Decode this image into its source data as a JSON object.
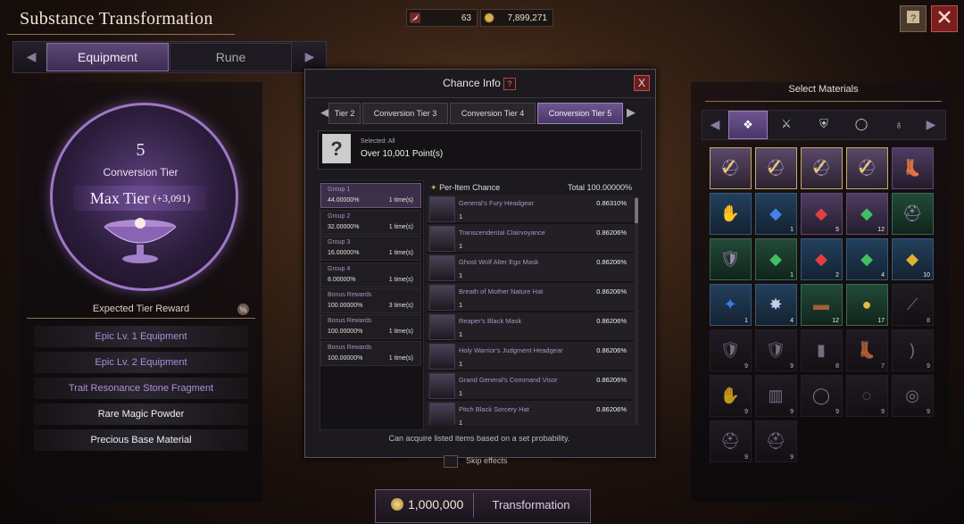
{
  "header": {
    "title": "Substance Transformation",
    "currency1": {
      "icon": "feather-icon",
      "value": "63"
    },
    "currency2": {
      "icon": "gold-coin-icon",
      "value": "7,899,271"
    }
  },
  "left": {
    "tabs": {
      "equipment": "Equipment",
      "rune": "Rune"
    },
    "tier": {
      "number": "5",
      "label": "Conversion Tier",
      "max_label": "Max Tier",
      "bonus": "(+3,091)"
    },
    "expected_title": "Expected Tier Reward",
    "pct_badge": "%",
    "rewards": [
      {
        "label": "Epic Lv. 1 Equipment",
        "color": "#b08ed9"
      },
      {
        "label": "Epic Lv. 2 Equipment",
        "color": "#b08ed9"
      },
      {
        "label": "Trait Resonance Stone Fragment",
        "color": "#b08ed9"
      },
      {
        "label": "Rare Magic Powder",
        "color": "#f0f0f0"
      },
      {
        "label": "Precious Base Material",
        "color": "#f0f0f0"
      }
    ]
  },
  "modal": {
    "title": "Chance Info",
    "help": "?",
    "close": "X",
    "tabs": [
      "Tier 2",
      "Conversion Tier 3",
      "Conversion Tier 4",
      "Conversion Tier 5"
    ],
    "tab0_visible": "Tier 2",
    "selected_label": "Selected: All",
    "selected_value": "Over 10,001 Point(s)",
    "groups": [
      {
        "name": "Group 1",
        "pct": "44.00000%",
        "times": "1 time(s)"
      },
      {
        "name": "Group 2",
        "pct": "32.00000%",
        "times": "1 time(s)"
      },
      {
        "name": "Group 3",
        "pct": "16.00000%",
        "times": "1 time(s)"
      },
      {
        "name": "Group 4",
        "pct": "8.00000%",
        "times": "1 time(s)"
      },
      {
        "name": "Bonus Rewards",
        "pct": "100.00000%",
        "times": "3 time(s)"
      },
      {
        "name": "Bonus Rewards",
        "pct": "100.00000%",
        "times": "1 time(s)"
      },
      {
        "name": "Bonus Rewards",
        "pct": "100.00000%",
        "times": "1 time(s)"
      }
    ],
    "list_header_left": "Per-Item Chance",
    "list_header_right": "Total 100.00000%",
    "items": [
      {
        "name": "General's Fury Headgear",
        "pct": "0.86310%",
        "count": "1"
      },
      {
        "name": "Transcendental Clairvoyance",
        "pct": "0.86206%",
        "count": "1"
      },
      {
        "name": "Ghost Wolf Alter Ego Mask",
        "pct": "0.86206%",
        "count": "1"
      },
      {
        "name": "Breath of Mother Nature Hat",
        "pct": "0.86206%",
        "count": "1"
      },
      {
        "name": "Reaper's Black Mask",
        "pct": "0.86206%",
        "count": "1"
      },
      {
        "name": "Holy Warrior's Judgment Headgear",
        "pct": "0.86206%",
        "count": "1"
      },
      {
        "name": "Grand General's Command Visor",
        "pct": "0.86206%",
        "count": "1"
      },
      {
        "name": "Pitch Black Sorcery Hat",
        "pct": "0.86206%",
        "count": "1"
      }
    ],
    "footer": "Can acquire listed items based on a set probability."
  },
  "skip_label": "Skip effects",
  "right": {
    "title": "Select Materials",
    "categories": [
      "all-icon",
      "weapon-icon",
      "armor-icon",
      "ring-icon",
      "pouch-icon"
    ],
    "slots": [
      {
        "type": "gold",
        "icon": "helmet-icon",
        "glyph": "⛑",
        "count": "",
        "checked": true
      },
      {
        "type": "gold",
        "icon": "helmet-icon",
        "glyph": "⛑",
        "count": "",
        "checked": true
      },
      {
        "type": "gold",
        "icon": "helmet-icon",
        "glyph": "⛑",
        "count": "",
        "checked": true
      },
      {
        "type": "gold",
        "icon": "helmet-icon",
        "glyph": "⛑",
        "count": "",
        "checked": true
      },
      {
        "type": "purple",
        "icon": "boots-icon",
        "glyph": "👢",
        "count": "",
        "checked": false
      },
      {
        "type": "blue",
        "icon": "gauntlet-icon",
        "glyph": "✋",
        "count": "",
        "checked": false
      },
      {
        "type": "blue",
        "icon": "blue-crystal-icon",
        "glyph": "◆",
        "count": "1",
        "color": "#4a7ee8",
        "checked": false
      },
      {
        "type": "purple",
        "icon": "red-crystal-icon",
        "glyph": "◆",
        "count": "5",
        "color": "#e04040",
        "checked": false
      },
      {
        "type": "purple",
        "icon": "green-crystal-icon",
        "glyph": "◆",
        "count": "12",
        "color": "#3fc060",
        "checked": false
      },
      {
        "type": "green",
        "icon": "helmet-icon",
        "glyph": "⛑",
        "count": "",
        "checked": false
      },
      {
        "type": "green",
        "icon": "chest-armor-icon",
        "glyph": "🛡",
        "count": "",
        "checked": false
      },
      {
        "type": "green",
        "icon": "green-crystal-icon",
        "glyph": "◆",
        "count": "1",
        "color": "#3fc060",
        "checked": false
      },
      {
        "type": "blue",
        "icon": "red-crystal-icon",
        "glyph": "◆",
        "count": "2",
        "color": "#e04040",
        "checked": false
      },
      {
        "type": "blue",
        "icon": "green-crystal-icon",
        "glyph": "◆",
        "count": "4",
        "color": "#3fc060",
        "checked": false
      },
      {
        "type": "blue",
        "icon": "yellow-crystal-icon",
        "glyph": "◆",
        "count": "10",
        "color": "#e0b030",
        "checked": false
      },
      {
        "type": "blue",
        "icon": "blue-star-crystal-icon",
        "glyph": "✦",
        "count": "1",
        "color": "#3a7cf0",
        "checked": false
      },
      {
        "type": "blue",
        "icon": "ore-icon",
        "glyph": "✸",
        "count": "4",
        "color": "#c0d0e8",
        "checked": false
      },
      {
        "type": "green",
        "icon": "wood-log-icon",
        "glyph": "▬",
        "count": "12",
        "color": "#a0603a",
        "checked": false
      },
      {
        "type": "green",
        "icon": "gold-nugget-icon",
        "glyph": "●",
        "count": "17",
        "color": "#e6b84a",
        "checked": false
      },
      {
        "type": "dim",
        "icon": "spear-icon",
        "glyph": "⟋",
        "count": "8",
        "checked": false
      },
      {
        "type": "dim",
        "icon": "chest-armor-icon",
        "glyph": "🛡",
        "count": "9",
        "checked": false
      },
      {
        "type": "dim",
        "icon": "chest-armor-icon",
        "glyph": "🛡",
        "count": "9",
        "checked": false
      },
      {
        "type": "dim",
        "icon": "leg-armor-icon",
        "glyph": "▮",
        "count": "8",
        "checked": false
      },
      {
        "type": "dim",
        "icon": "boots-icon",
        "glyph": "👢",
        "count": "7",
        "checked": false
      },
      {
        "type": "dim",
        "icon": "bow-icon",
        "glyph": ")",
        "count": "9",
        "checked": false
      },
      {
        "type": "dim",
        "icon": "gauntlet-icon",
        "glyph": "✋",
        "count": "9",
        "checked": false
      },
      {
        "type": "dim",
        "icon": "cloak-icon",
        "glyph": "▥",
        "count": "9",
        "checked": false
      },
      {
        "type": "dim",
        "icon": "belt-icon",
        "glyph": "◯",
        "count": "9",
        "checked": false
      },
      {
        "type": "dim",
        "icon": "necklace-icon",
        "glyph": "◌",
        "count": "9",
        "checked": false
      },
      {
        "type": "dim",
        "icon": "bracelet-icon",
        "glyph": "◎",
        "count": "9",
        "checked": false
      },
      {
        "type": "dim",
        "icon": "helmet-icon",
        "glyph": "⛑",
        "count": "9",
        "checked": false
      },
      {
        "type": "dim",
        "icon": "helmet-icon",
        "glyph": "⛑",
        "count": "9",
        "checked": false
      }
    ]
  },
  "bottom": {
    "cost": "1,000,000",
    "action": "Transformation"
  }
}
